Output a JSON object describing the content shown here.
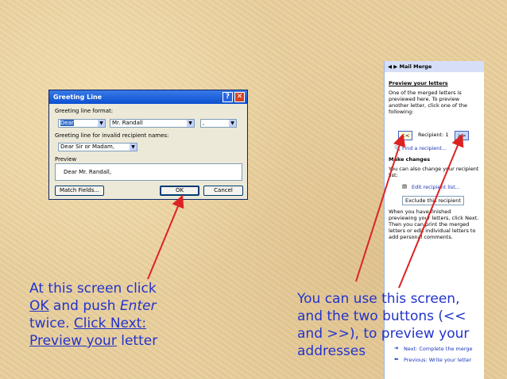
{
  "dialog": {
    "title": "Greeting Line",
    "help_btn": "?",
    "close_btn": "✕",
    "format_label": "Greeting line format:",
    "salutation": "Dear",
    "name_format": "Mr. Randall",
    "punctuation": ",",
    "invalid_label": "Greeting line for invalid recipient names:",
    "invalid_value": "Dear Sir or Madam,",
    "preview_label": "Preview",
    "preview_text": "Dear Mr. Randall,",
    "match_fields": "Match Fields...",
    "ok": "OK",
    "cancel": "Cancel"
  },
  "pane": {
    "title": "Mail Merge",
    "section1": "Preview your letters",
    "desc1_l1": "One of the merged letters is",
    "desc1_l2": "previewed here. To preview",
    "desc1_l3": "another letter, click one of the",
    "desc1_l4": "following:",
    "prev_btn": "<<",
    "recipient": "Recipient: 1",
    "next_btn": ">>",
    "find": "Find a recipient...",
    "section2": "Make changes",
    "desc2_l1": "You can also change your recipient",
    "desc2_l2": "list:",
    "edit_list": "Edit recipient list...",
    "exclude": "Exclude this recipient",
    "desc3_l1": "When you have finished",
    "desc3_l2": "previewing your letters, click Next.",
    "desc3_l3": "Then you can print the merged",
    "desc3_l4": "letters or edit individual letters to",
    "desc3_l5": "add personal comments.",
    "next_step": "Next: Complete the merge",
    "prev_step": "Previous: Write your letter"
  },
  "captions": {
    "left_1": "At this screen click",
    "left_ok": "OK",
    "left_2": " and push ",
    "left_enter": "Enter",
    "left_3": "twice. ",
    "left_click_next": "Click Next:",
    "left_preview": "Preview your",
    "left_4": " letter",
    "right_1": "You can use this screen,",
    "right_2": "and the two buttons (<<",
    "right_3": "and >>), to preview your",
    "right_4": "addresses"
  },
  "colors": {
    "arrow": "#dd2222",
    "caption": "#2233cc",
    "titlebar": "#0b4fd0"
  }
}
